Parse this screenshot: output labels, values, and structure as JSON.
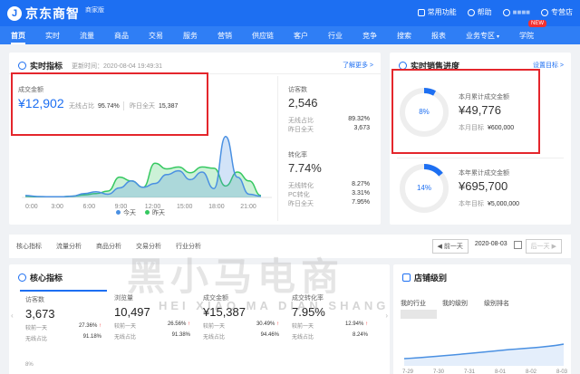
{
  "header": {
    "logo_text": "京东商智",
    "logo_sub": "商家版",
    "common_func": "常用功能",
    "help": "帮助",
    "user_masked": "■■■■",
    "store_label": "专营店"
  },
  "nav": [
    "首页",
    "实时",
    "流量",
    "商品",
    "交易",
    "服务",
    "营销",
    "供应链",
    "客户",
    "行业",
    "竞争",
    "搜索",
    "报表",
    "业务专区",
    "学院"
  ],
  "nav_new_badge": "NEW",
  "realtime": {
    "title": "实时指标",
    "updated": "更新时间：2020-08-04 19:49:31",
    "more_link": "了解更多 >",
    "gmv_label": "成交金额",
    "gmv_value": "¥12,902",
    "wireless_label": "无线占比",
    "wireless_value": "95.74%",
    "yesterday_label": "昨日全天",
    "yesterday_value": "15,387",
    "visitors_label": "访客数",
    "visitors_value": "2,546",
    "visitors_wireless_label": "无线占比",
    "visitors_wireless_value": "89.32%",
    "visitors_yesterday_label": "昨日全天",
    "visitors_yesterday_value": "3,673",
    "conv_label": "转化率",
    "conv_value": "7.74%",
    "conv_rows": [
      {
        "k": "无线转化",
        "v": "8.27%"
      },
      {
        "k": "PC转化",
        "v": "3.31%"
      },
      {
        "k": "昨日全天",
        "v": "7.95%"
      }
    ]
  },
  "chart_data": {
    "type": "area",
    "categories": [
      "0:00",
      "3:00",
      "6:00",
      "9:00",
      "12:00",
      "15:00",
      "18:00",
      "21:00"
    ],
    "series": [
      {
        "name": "今天",
        "color": "#4a90e2",
        "values": [
          0.3,
          0.15,
          0.1,
          0.1,
          0.2,
          0.6,
          0.9,
          0.5,
          1.5,
          2.6,
          1.6,
          2.2,
          3.6,
          4.2,
          2.8,
          4.0,
          1.4,
          9.6,
          3.2,
          0.5,
          0.2
        ]
      },
      {
        "name": "昨天",
        "color": "#35c860",
        "values": [
          0.2,
          0.1,
          0.1,
          0.1,
          0.2,
          0.4,
          0.6,
          1.0,
          3.2,
          2.6,
          1.6,
          5.4,
          4.5,
          4.8,
          3.9,
          4.8,
          4.6,
          1.8,
          4.0,
          2.6,
          0.3
        ]
      }
    ],
    "ylim": [
      0,
      10
    ],
    "legend": "bottom-center"
  },
  "sales_progress": {
    "title": "实时销售进度",
    "settings_link": "设置目标 >",
    "monthly_label": "本月累计成交金额",
    "monthly_value": "¥49,776",
    "monthly_target_label": "本月目标",
    "monthly_target_value": "¥600,000",
    "monthly_pct": "8%",
    "monthly_progress": 0.08,
    "yearly_label": "本年累计成交金额",
    "yearly_value": "¥695,700",
    "yearly_target_label": "本年目标",
    "yearly_target_value": "¥5,000,000",
    "yearly_pct": "14%",
    "yearly_progress": 0.14
  },
  "tabs": [
    "核心指标",
    "流量分析",
    "商品分析",
    "交易分析",
    "行业分析"
  ],
  "date_ctl": {
    "prev": "◀ 前一天",
    "date": "2020-08-03",
    "next": "后一天 ▶"
  },
  "core": {
    "title": "核心指标",
    "metrics": [
      {
        "name": "访客数",
        "val": "3,673",
        "r1k": "较前一天",
        "r1v": "27.36%",
        "r2k": "无线占比",
        "r2v": "91.18%"
      },
      {
        "name": "浏览量",
        "val": "10,497",
        "r1k": "较前一天",
        "r1v": "26.56%",
        "r2k": "无线占比",
        "r2v": "91.38%"
      },
      {
        "name": "成交金额",
        "val": "¥15,387",
        "r1k": "较前一天",
        "r1v": "30.49%",
        "r2k": "无线占比",
        "r2v": "94.46%"
      },
      {
        "name": "成交转化率",
        "val": "7.95%",
        "r1k": "较前一天",
        "r1v": "12.94%",
        "r2k": "无线占比",
        "r2v": "8.24%"
      }
    ],
    "axis_label": "8%"
  },
  "store": {
    "title": "店铺级别",
    "cols": [
      "我的行业",
      "我的级别",
      "级别排名"
    ],
    "x_ticks": [
      "7-29",
      "7-30",
      "7-31",
      "8-01",
      "8-02",
      "8-03"
    ]
  },
  "watermark": "黑小马电商",
  "watermark_en": "HEI XIAO MA DIAN SHANG",
  "colors": {
    "brand": "#1d6ff2",
    "highlight": "#e4262c"
  }
}
